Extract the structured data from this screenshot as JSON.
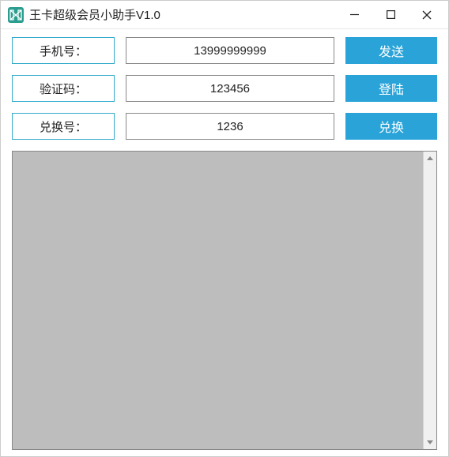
{
  "window": {
    "title": "王卡超级会员小助手V1.0"
  },
  "form": {
    "phone": {
      "label": "手机号：",
      "value": "13999999999",
      "button": "发送"
    },
    "code": {
      "label": "验证码：",
      "value": "123456",
      "button": "登陆"
    },
    "redeem": {
      "label": "兑换号：",
      "value": "1236",
      "button": "兑换"
    }
  },
  "log": {
    "content": ""
  },
  "colors": {
    "accent": "#2aa3d8",
    "border_accent": "#33aacc"
  }
}
